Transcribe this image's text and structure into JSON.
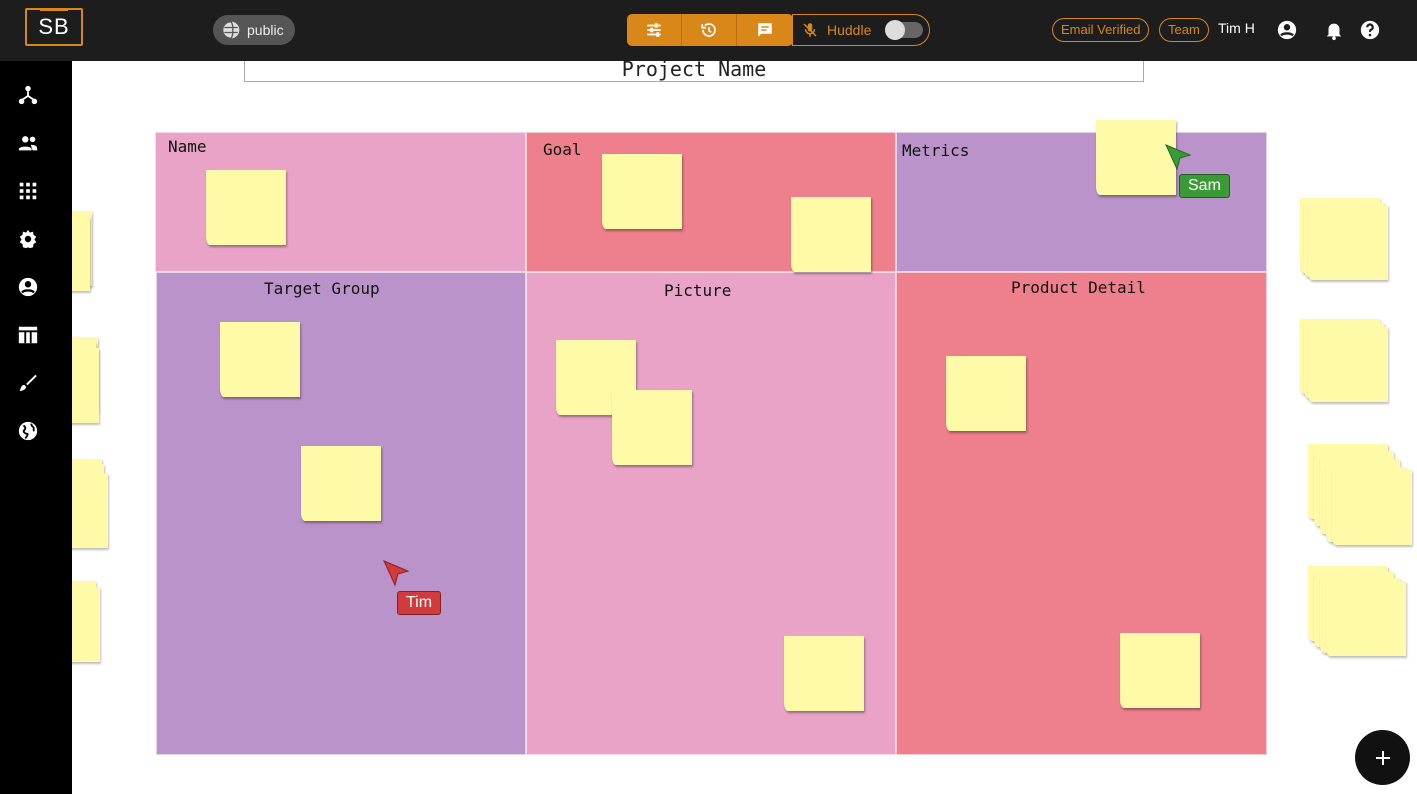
{
  "app": {
    "logo_text": "SB"
  },
  "header": {
    "visibility_label": "public",
    "huddle_label": "Huddle",
    "email_badge": "Email Verified",
    "team_badge": "Team",
    "user_name": "Tim H",
    "accent_color": "#d88718"
  },
  "toolbar_icons": [
    "sliders-icon",
    "history-icon",
    "chat-icon"
  ],
  "sidebar_icons": [
    "network-icon",
    "people-icon",
    "grid-icon",
    "gear-icon",
    "account-icon",
    "table-icon",
    "brush-icon",
    "globe-icon"
  ],
  "board": {
    "project_title": "Project Name",
    "cells": {
      "name": "Name",
      "goal": "Goal",
      "metrics": "Metrics",
      "target_group": "Target Group",
      "picture": "Picture",
      "product_detail": "Product Detail"
    },
    "colors": {
      "pink": "#e8a3c6",
      "red": "#ee7f8c",
      "purple": "#b993c9",
      "note": "#fffaa8"
    }
  },
  "collaborators": [
    {
      "name": "Sam",
      "color": "#3a9a36"
    },
    {
      "name": "Tim",
      "color": "#d13b3b"
    }
  ]
}
